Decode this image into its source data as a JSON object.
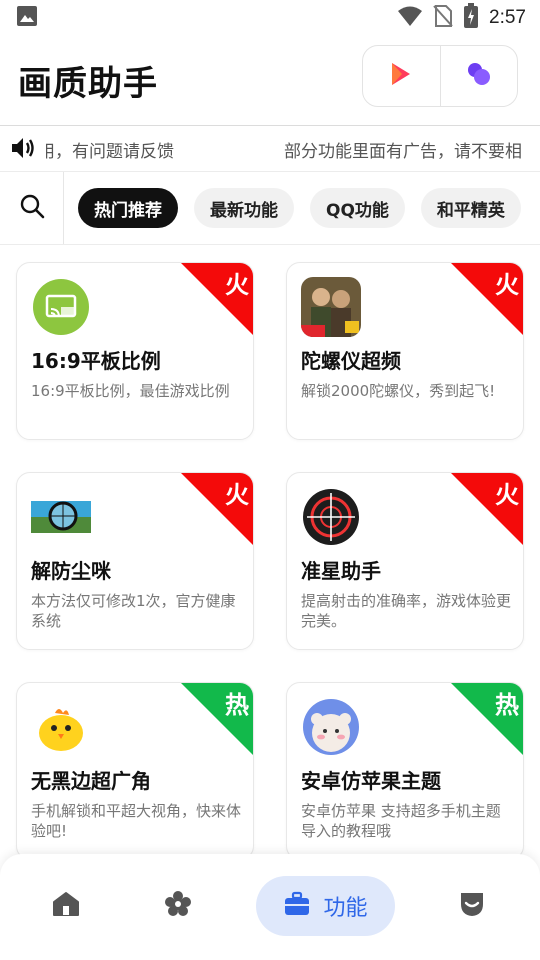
{
  "status_bar": {
    "time": "2:57"
  },
  "header": {
    "title": "画质助手"
  },
  "marquee": {
    "text_1": "用，有问题请反馈",
    "text_2": "部分功能里面有广告，请不要相"
  },
  "categories": [
    "热门推荐",
    "最新功能",
    "QQ功能",
    "和平精英"
  ],
  "cards": [
    {
      "title": "16:9平板比例",
      "desc": "16:9平板比例，最佳游戏比例",
      "badge": "火",
      "badge_color": "#f40a0a",
      "icon": "tablet-cast-icon"
    },
    {
      "title": "陀螺仪超频",
      "desc": "解锁2000陀螺仪，秀到起飞!",
      "badge": "火",
      "badge_color": "#f40a0a",
      "icon": "game-characters-icon"
    },
    {
      "title": "解防尘咪",
      "desc": "本方法仅可修改1次，官方健康系统",
      "badge": "火",
      "badge_color": "#f40a0a",
      "icon": "scope-view-icon"
    },
    {
      "title": "准星助手",
      "desc": "提高射击的准确率，游戏体验更完美。",
      "badge": "火",
      "badge_color": "#f40a0a",
      "icon": "crosshair-icon"
    },
    {
      "title": "无黑边超广角",
      "desc": "手机解锁和平超大视角，快来体验吧!",
      "badge": "热",
      "badge_color": "#12b94b",
      "icon": "chick-icon"
    },
    {
      "title": "安卓仿苹果主题",
      "desc": "安卓仿苹果 支持超多手机主题导入的教程哦",
      "badge": "热",
      "badge_color": "#12b94b",
      "icon": "bear-avatar-icon"
    }
  ],
  "bottom_nav": {
    "items": [
      {
        "name": "home",
        "icon": "home-icon"
      },
      {
        "name": "discover",
        "icon": "flower-icon"
      },
      {
        "name": "features",
        "icon": "briefcase-icon",
        "label": "功能",
        "active": true
      },
      {
        "name": "profile",
        "icon": "shield-icon"
      }
    ]
  },
  "colors": {
    "accent": "#2f67e8",
    "accent_bg": "#dfe8fb",
    "hot_red": "#f40a0a",
    "hot_green": "#12b94b"
  }
}
